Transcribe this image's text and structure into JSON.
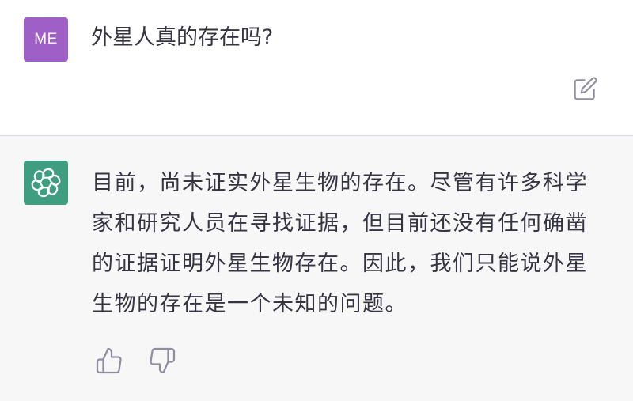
{
  "user": {
    "avatar_initials": "ME",
    "avatar_color": "#9e5fc7",
    "message": "外星人真的存在吗?",
    "edit_icon": "edit-icon"
  },
  "assistant": {
    "avatar_icon": "openai-logo-icon",
    "avatar_color": "#3f9e7f",
    "message": "目前，尚未证实外星生物的存在。尽管有许多科学家和研究人员在寻找证据，但目前还没有任何确凿的证据证明外星生物存在。因此，我们只能说外星生物的存在是一个未知的问题。",
    "feedback_icons": [
      "thumbs-up-icon",
      "thumbs-down-icon"
    ]
  },
  "colors": {
    "assistant_background": "#f7f7f8",
    "divider": "#d9d9e3",
    "text": "#343541",
    "icon": "#8e8ea0"
  }
}
